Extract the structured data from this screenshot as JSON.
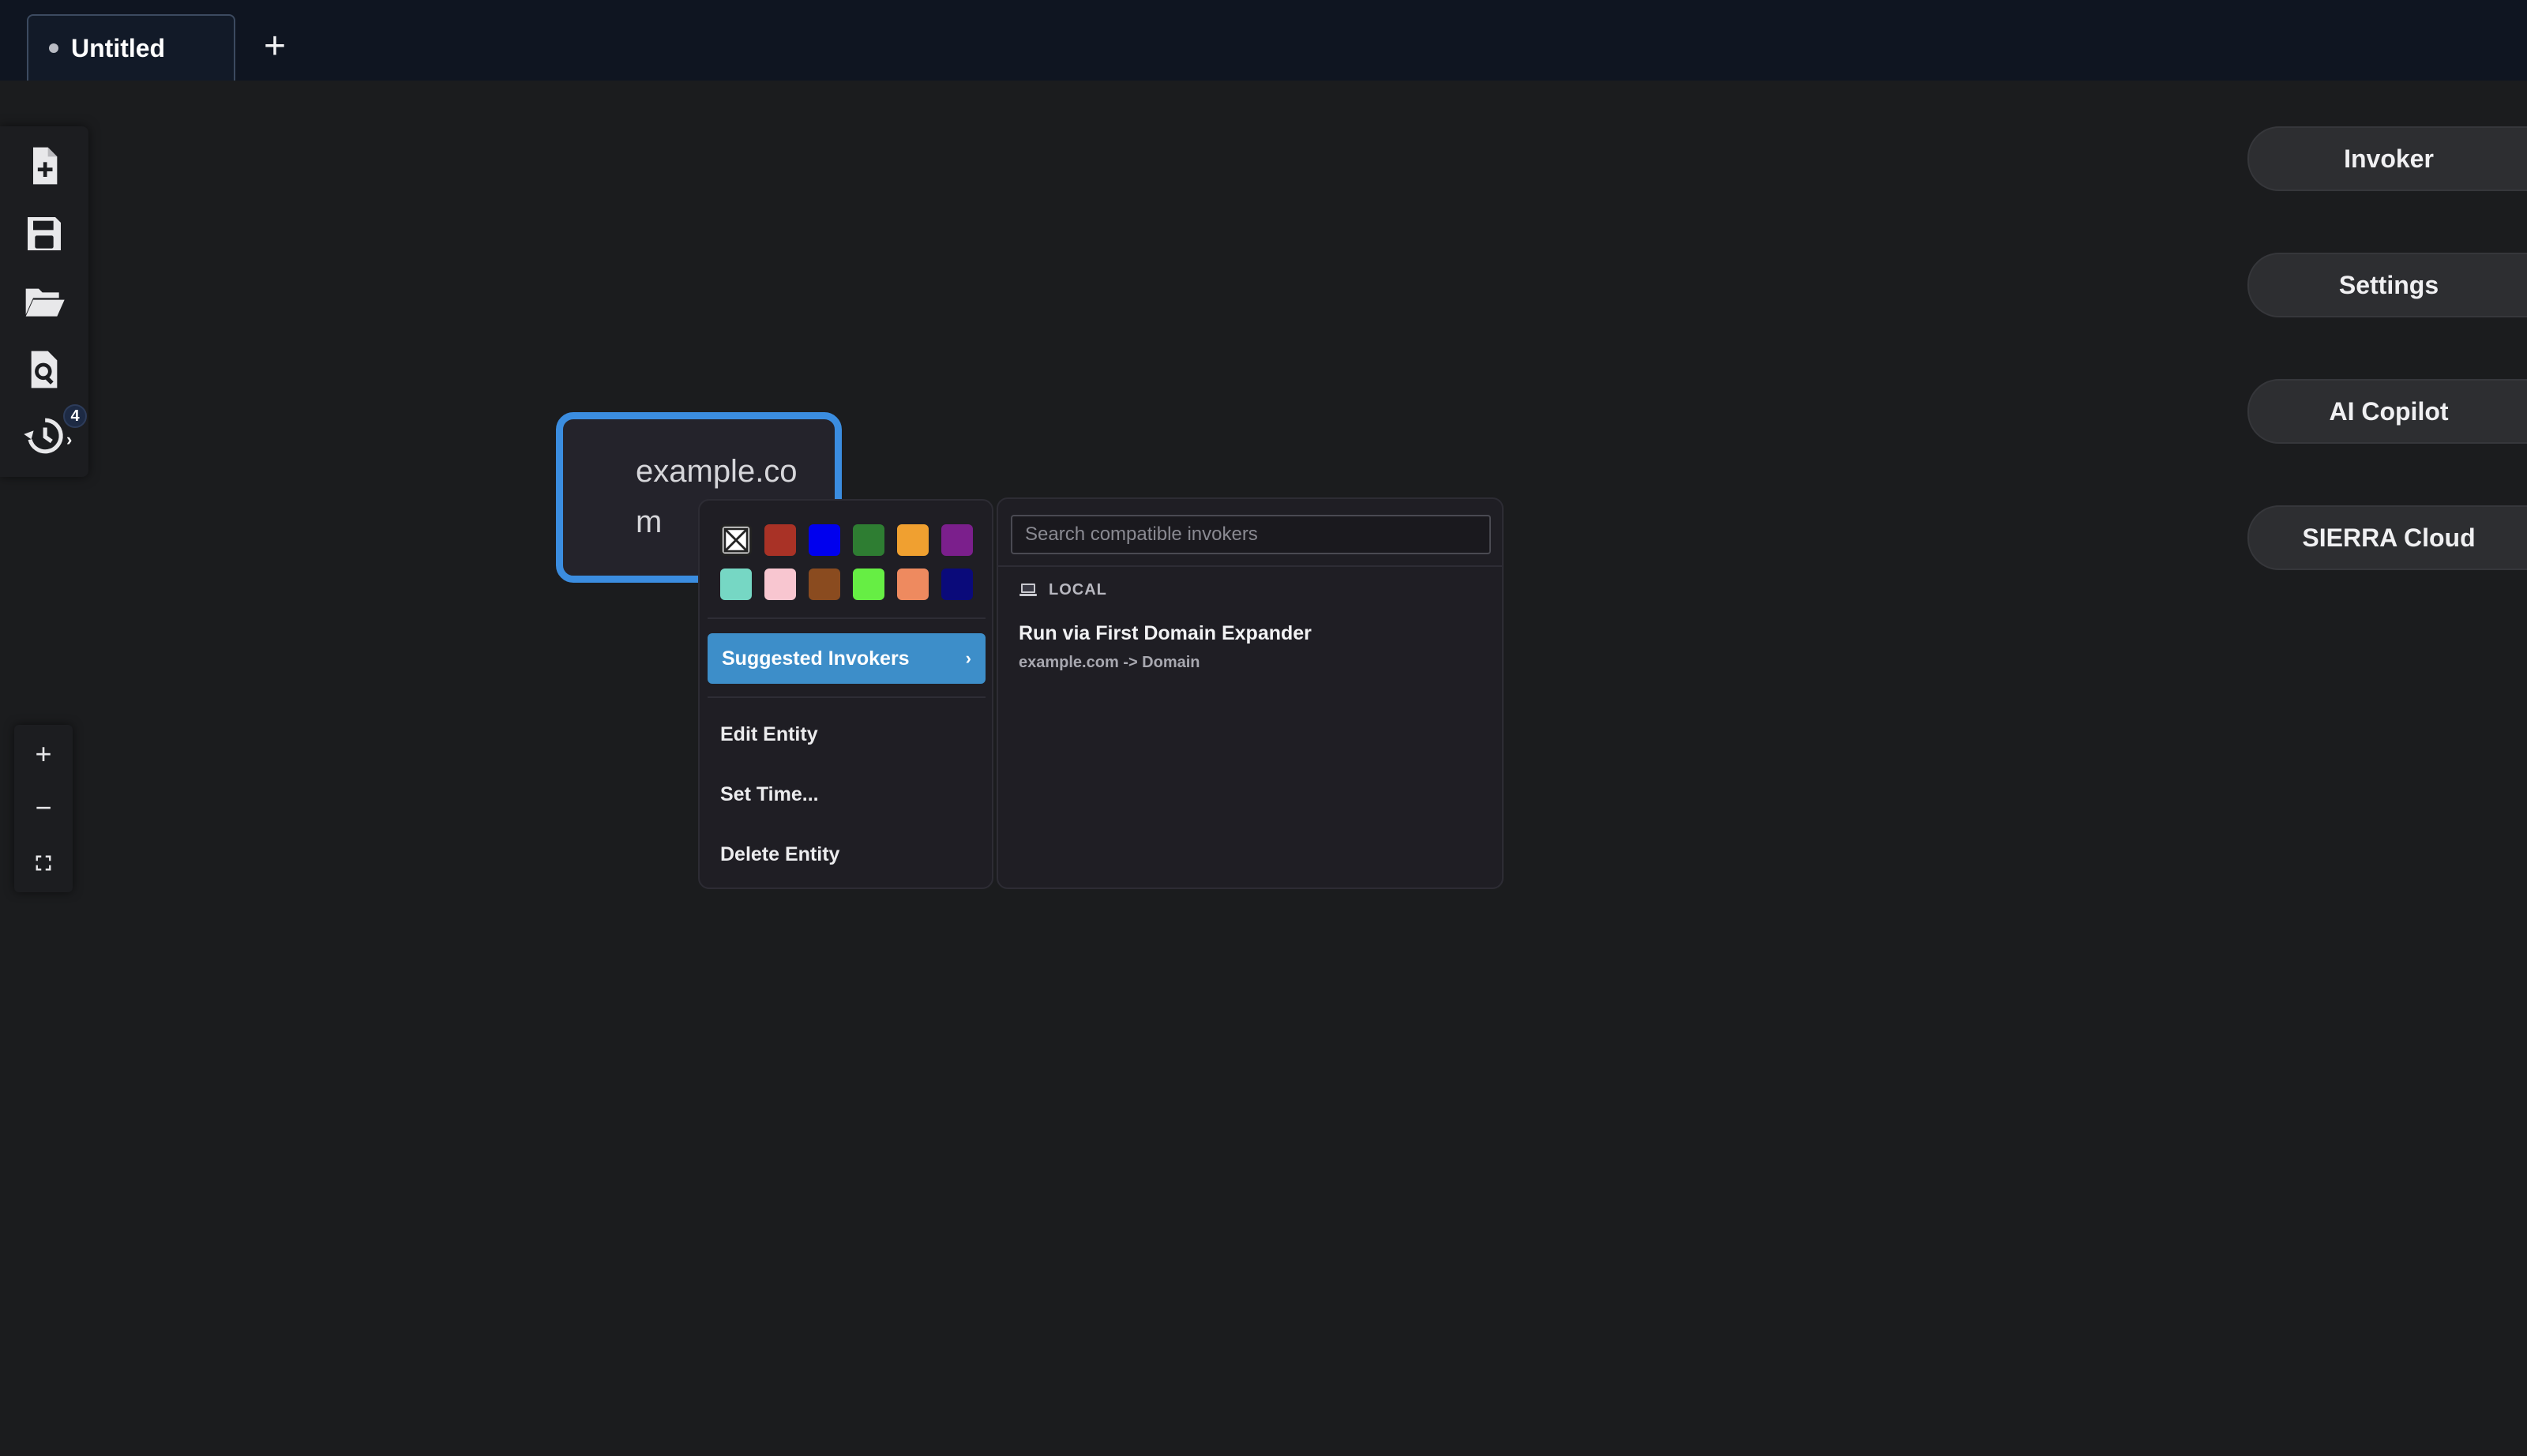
{
  "tabs": {
    "active": {
      "label": "Untitled"
    },
    "add_label": "+"
  },
  "toolbar": {
    "items": [
      {
        "name": "new-document",
        "icon": "file-plus-icon"
      },
      {
        "name": "save",
        "icon": "floppy-disk-icon"
      },
      {
        "name": "open",
        "icon": "folder-open-icon"
      },
      {
        "name": "search",
        "icon": "file-search-icon"
      },
      {
        "name": "history",
        "icon": "history-clock-icon"
      }
    ],
    "history_badge": "4"
  },
  "zoom": {
    "zoom_in": "+",
    "zoom_out": "−",
    "fit": "fit-screen-icon"
  },
  "right_panel": {
    "invoker": "Invoker",
    "settings": "Settings",
    "ai_copilot": "AI Copilot",
    "sierra_cloud": "SIERRA Cloud"
  },
  "entity": {
    "text": "example.com"
  },
  "context_menu": {
    "colors": [
      "none",
      "#a93226",
      "#0000ee",
      "#2e7d32",
      "#f0a030",
      "#7b1f8c",
      "#76d7c4",
      "#f8c6d0",
      "#8a4b1f",
      "#66ee44",
      "#ee8a5f",
      "#0a0a7a"
    ],
    "suggested_invokers": "Suggested Invokers",
    "suggested_chevron": "›",
    "edit_entity": "Edit Entity",
    "set_time": "Set Time...",
    "delete_entity": "Delete Entity"
  },
  "invoker_panel": {
    "search_placeholder": "Search compatible invokers",
    "search_value": "",
    "group_label": "LOCAL",
    "group_icon": "laptop-icon",
    "items": [
      {
        "title": "Run via First Domain Expander",
        "subtitle": "example.com -> Domain"
      }
    ]
  }
}
